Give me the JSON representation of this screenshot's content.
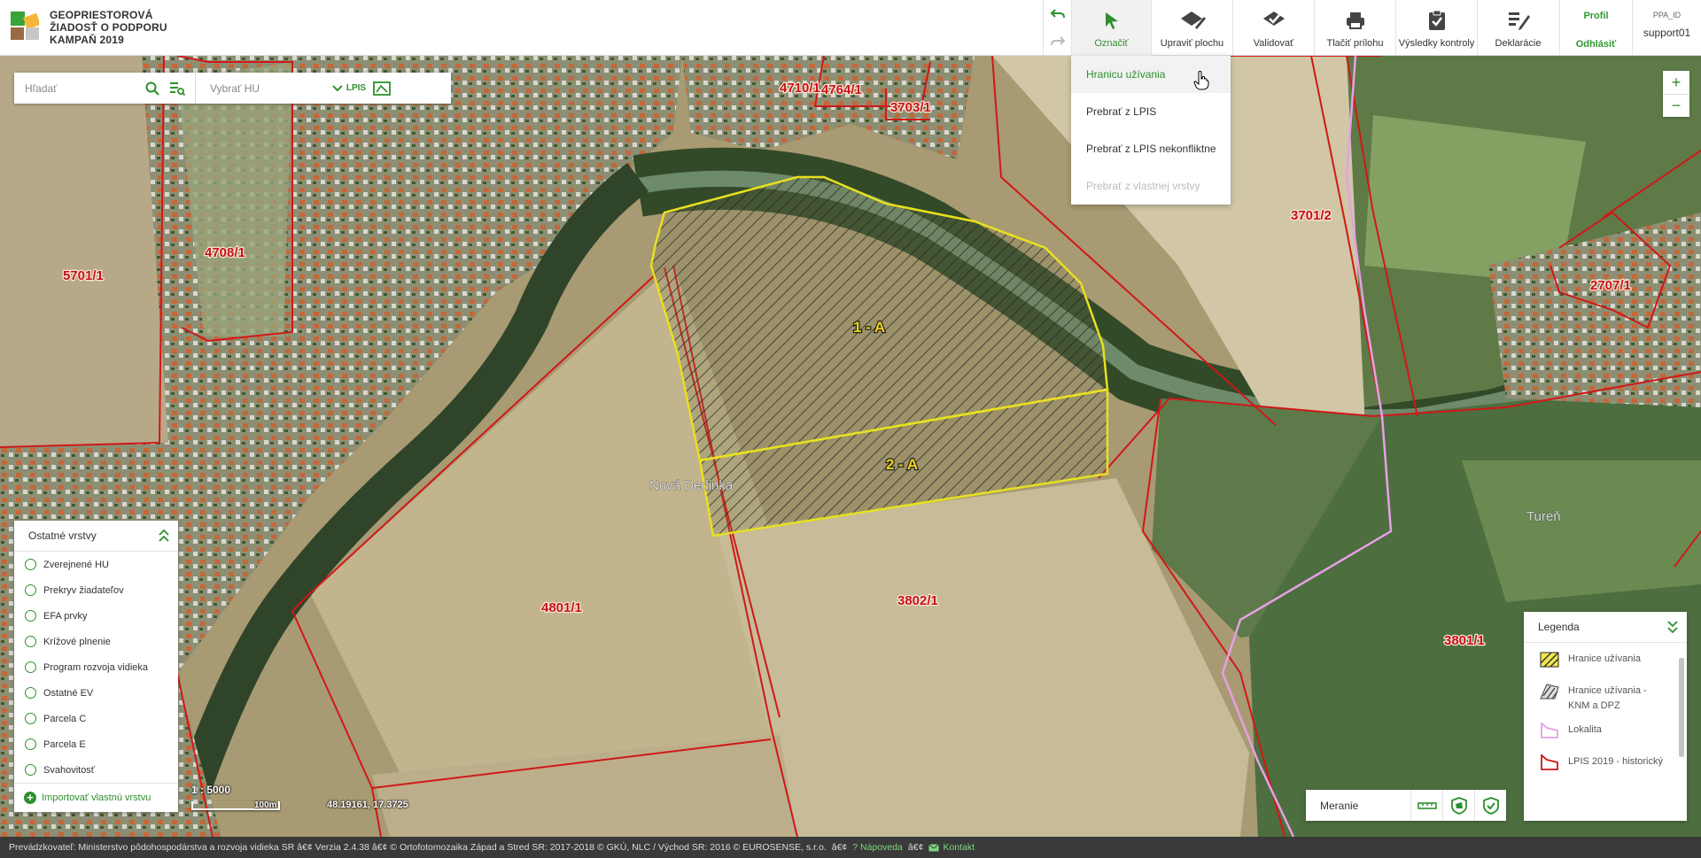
{
  "brand": {
    "line1": "GEOPRIESTOROVÁ",
    "line2": "ŽIADOSŤ O PODPORU",
    "line3": "KAMPAŇ 2019"
  },
  "toolbar": {
    "undo_icon": "undo-icon",
    "redo_icon": "redo-icon",
    "tools": [
      {
        "label": "Označiť",
        "icon": "cursor-arrow-icon",
        "active": true
      },
      {
        "label": "Upraviť plochu",
        "icon": "edit-area-icon"
      },
      {
        "label": "Validovať",
        "icon": "validate-icon"
      },
      {
        "label": "Tlačiť prílohu",
        "icon": "printer-icon"
      },
      {
        "label": "Výsledky kontroly",
        "icon": "clipboard-check-icon"
      },
      {
        "label": "Deklarácie",
        "icon": "declaration-icon"
      }
    ],
    "profile": "Profil",
    "logout": "Odhlásiť",
    "ppa_label": "PPA_ID",
    "username": "support01"
  },
  "select_menu": {
    "items": [
      {
        "label": "Hranicu užívania",
        "state": "highlighted"
      },
      {
        "label": "Prebrať z LPIS",
        "state": "normal"
      },
      {
        "label": "Prebrať z LPIS nekonfliktne",
        "state": "normal"
      },
      {
        "label": "Prebrať z vlastnej vrstvy",
        "state": "disabled"
      }
    ]
  },
  "search": {
    "placeholder": "Hľadať",
    "hu_placeholder": "Vybrať HU",
    "lpis_label": "LPIS"
  },
  "zoom": {
    "in": "+",
    "out": "−"
  },
  "layers": {
    "title": "Ostatné vrstvy",
    "items": [
      "Zverejnené HU",
      "Prekryv žiadateľov",
      "EFA prvky",
      "Krížové plnenie",
      "Program rozvoja vidieka",
      "Ostatné EV",
      "Parcela C",
      "Parcela E",
      "Svahovitosť"
    ],
    "import_label": "Importovať vlastnú vrstvu"
  },
  "map": {
    "parcels": [
      "4710/1",
      "4764/1",
      "3703/1",
      "/1",
      "4708/1",
      "5701/1",
      "3701/2",
      "2707/1",
      "4801/1",
      "3802/1",
      "3801/1"
    ],
    "hu_blocks": [
      "1 - A",
      "2 - A"
    ],
    "places": [
      "Nová Dedinka",
      "Tureň"
    ],
    "colors": {
      "lpis": "#d01818",
      "hu": "#e8e020",
      "locality": "#e0a0e0"
    }
  },
  "scale": {
    "ratio": "1 : 5000",
    "bar_label": "100m",
    "coords": "48.19161, 17.3725"
  },
  "measure": {
    "label": "Meranie"
  },
  "legend": {
    "title": "Legenda",
    "items": [
      {
        "label": "Hranice užívania",
        "symbol": "yellow-hatch"
      },
      {
        "label": "Hranice užívania - KNM a DPZ",
        "symbol": "gray-hatch"
      },
      {
        "label": "Lokalita",
        "symbol": "pink-outline"
      },
      {
        "label": "LPIS 2019 - historický",
        "symbol": "red-outline"
      }
    ]
  },
  "footer": {
    "text": "Prevádzkovateľ: Ministerstvo pôdohospodárstva a rozvoja vidieka SR â€¢ Verzia 2.4.38 â€¢ © Ortofotomozaika Západ a Stred SR: 2017-2018 © GKÚ, NLC / Východ SR: 2016 © EUROSENSE, s.r.o. ",
    "sep1": "â€¢",
    "help": "Nápoveda",
    "sep2": "â€¢",
    "contact": "Kontakt"
  }
}
